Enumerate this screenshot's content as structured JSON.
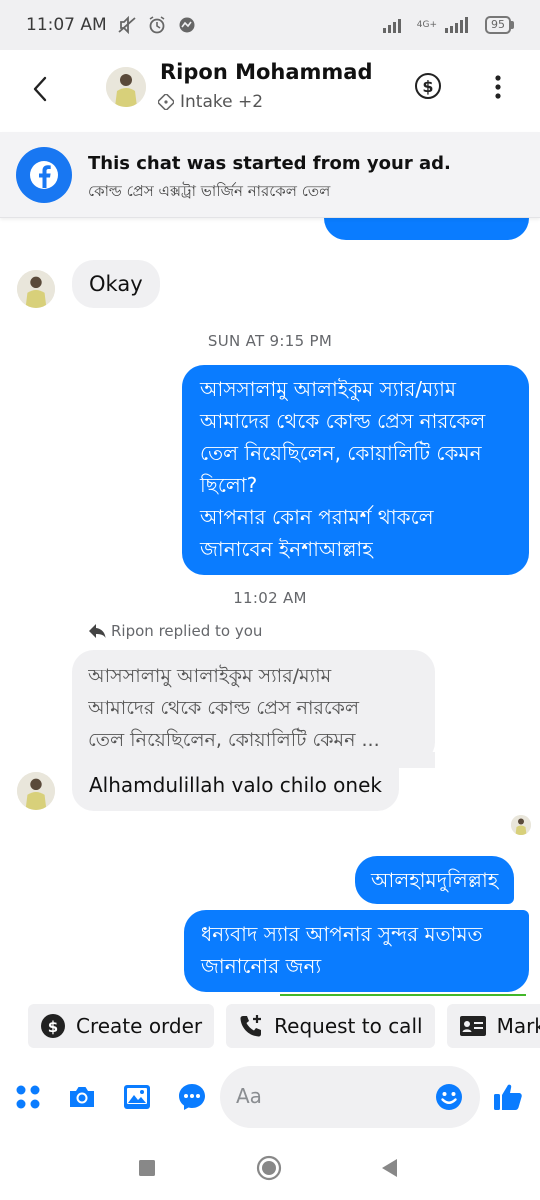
{
  "status_bar": {
    "time": "11:07 AM",
    "icons": [
      "mute-icon",
      "alarm-icon",
      "messenger-icon"
    ],
    "network": "4G+",
    "battery": "95"
  },
  "header": {
    "name": "Ripon Mohammad",
    "subtitle": "Intake +2"
  },
  "ad_banner": {
    "title": "This chat was started from your ad.",
    "subtitle": "কোল্ড প্রেস এক্সট্রা ভার্জিন নারকেল তেল"
  },
  "messages": {
    "okay": "Okay",
    "timestamp_1": "SUN AT 9:15 PM",
    "outgoing_1": [
      "আসসালামু আলাইকুম স্যার/ম্যাম",
      "আমাদের থেকে কোল্ড প্রেস নারকেল",
      "তেল নিয়েছিলেন,  কোয়ালিটি কেমন",
      "ছিলো?",
      "আপনার কোন পরামর্শ থাকলে",
      "জানাবেন ইনশাআল্লাহ"
    ],
    "timestamp_2": "11:02 AM",
    "reply_label": "Ripon replied to you",
    "quoted": [
      "আসসালামু আলাইকুম স্যার/ম্যাম",
      "আমাদের থেকে কোল্ড প্রেস নারকেল",
      "তেল নিয়েছিলেন,  কোয়ালিটি কেমন ..."
    ],
    "reply": "Alhamdulillah valo chilo onek",
    "outgoing_2": "আলহামদুলিল্লাহ",
    "outgoing_3": [
      "ধন্যবাদ স্যার আপনার সুন্দর মতামত",
      "জানানোর জন্য"
    ]
  },
  "chips": {
    "create_order": "Create order",
    "request_call": "Request to call",
    "mark": "Mark"
  },
  "composer": {
    "placeholder": "Aa"
  },
  "colors": {
    "accent": "#0a7cff",
    "brand": "#1877f2",
    "incoming_bg": "#f0f0f2"
  }
}
